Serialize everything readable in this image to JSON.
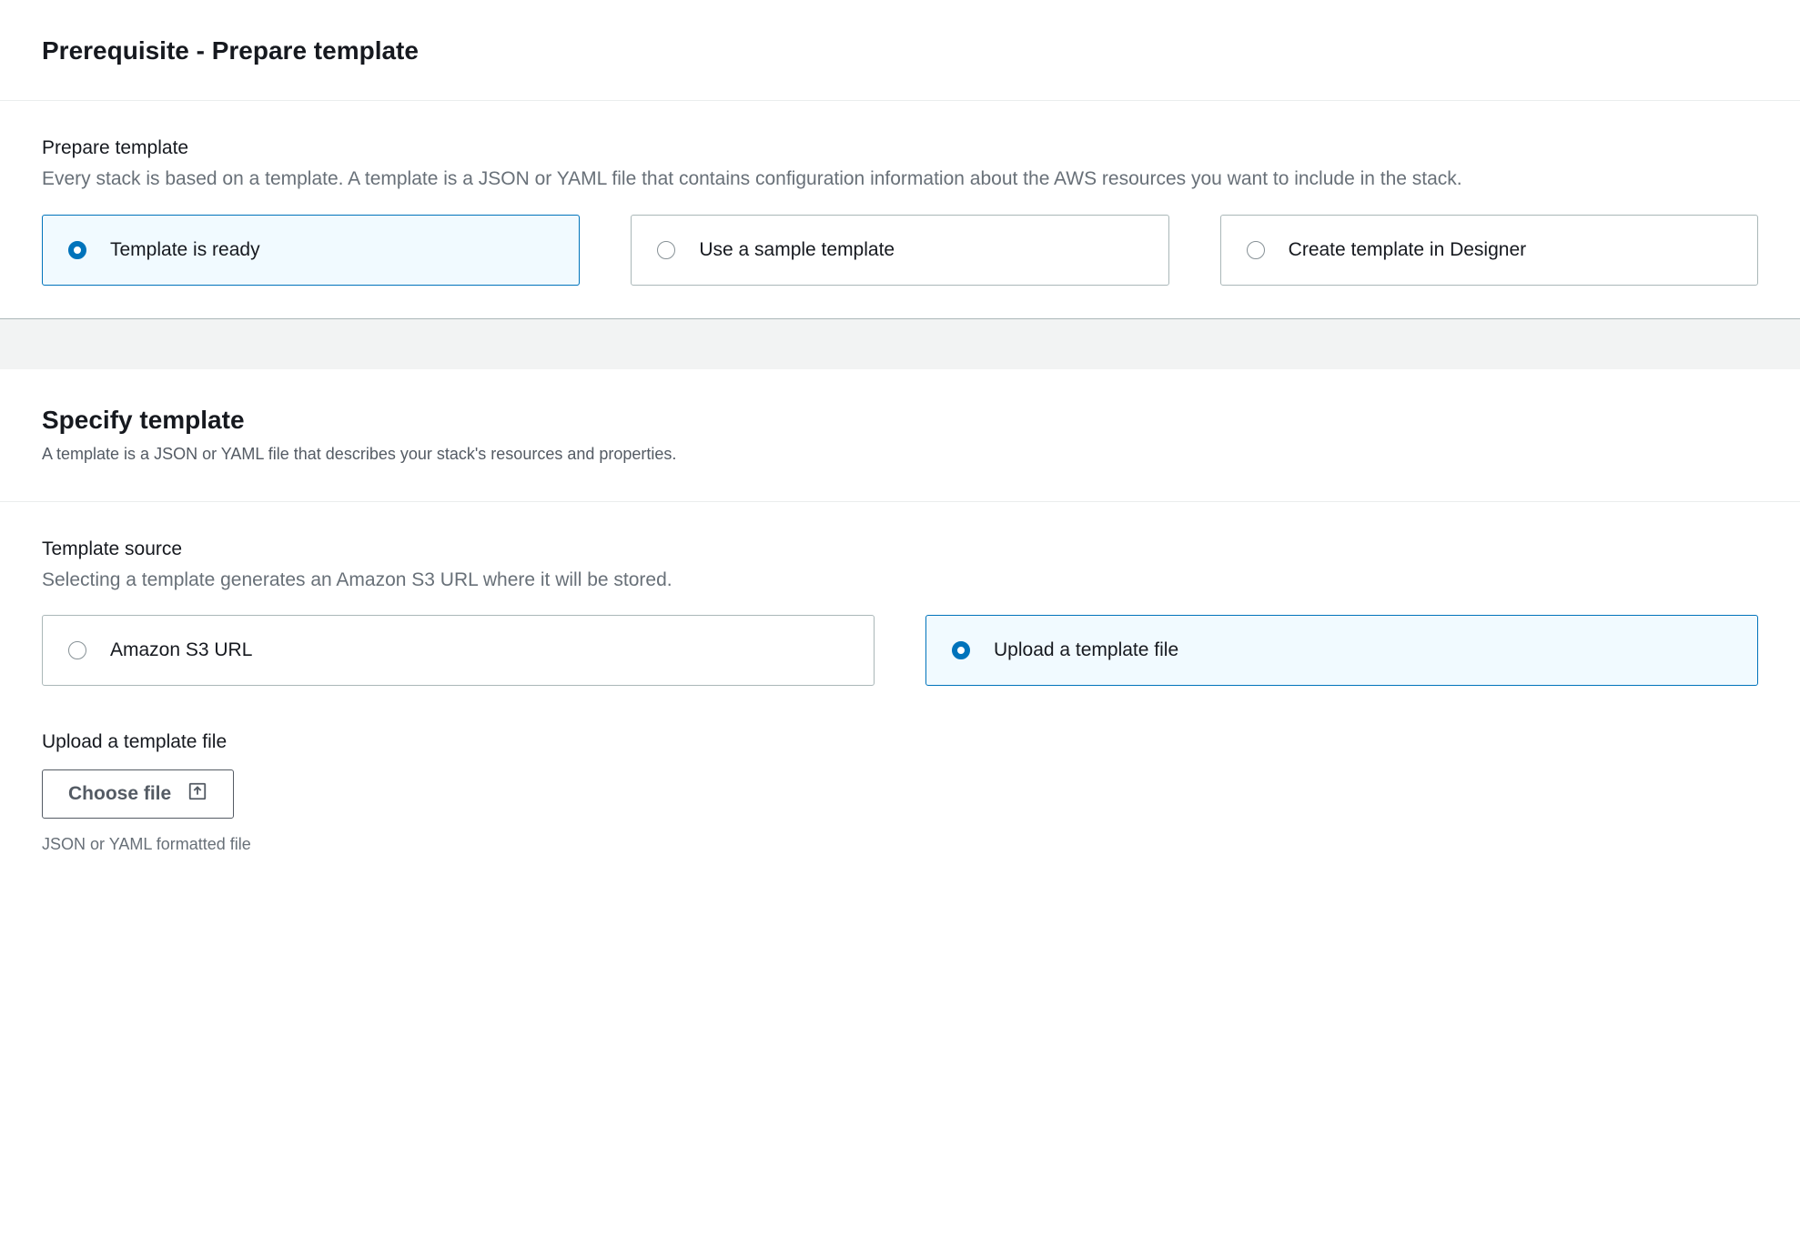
{
  "prerequisite": {
    "title": "Prerequisite - Prepare template",
    "field_label": "Prepare template",
    "field_desc": "Every stack is based on a template. A template is a JSON or YAML file that contains configuration information about the AWS resources you want to include in the stack.",
    "options": [
      {
        "label": "Template is ready",
        "selected": true
      },
      {
        "label": "Use a sample template",
        "selected": false
      },
      {
        "label": "Create template in Designer",
        "selected": false
      }
    ]
  },
  "specify": {
    "title": "Specify template",
    "subtitle": "A template is a JSON or YAML file that describes your stack's resources and properties.",
    "source_label": "Template source",
    "source_desc": "Selecting a template generates an Amazon S3 URL where it will be stored.",
    "options": [
      {
        "label": "Amazon S3 URL",
        "selected": false
      },
      {
        "label": "Upload a template file",
        "selected": true
      }
    ],
    "upload_label": "Upload a template file",
    "choose_label": "Choose file",
    "hint": "JSON or YAML formatted file"
  }
}
